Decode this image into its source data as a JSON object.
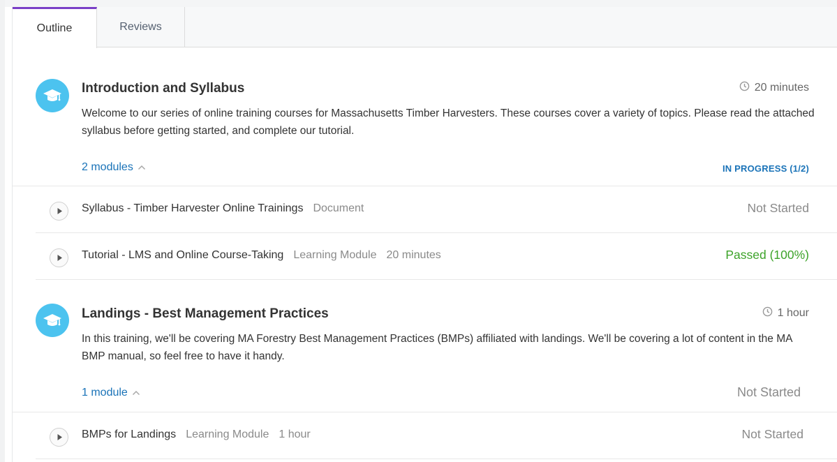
{
  "tabs": [
    {
      "label": "Outline"
    },
    {
      "label": "Reviews"
    }
  ],
  "colors": {
    "accent_tab": "#7a3fc7",
    "icon_bg": "#4cc3ef",
    "link": "#1a73b8",
    "passed": "#3da32a"
  },
  "sections": [
    {
      "title": "Introduction and Syllabus",
      "duration": "20 minutes",
      "description": "Welcome to our series of online training courses for Massachusetts Timber Harvesters. These courses cover a variety of topics. Please read the attached syllabus before getting started, and complete our tutorial.",
      "modules_label": "2 modules",
      "status": "IN PROGRESS (1/2)",
      "items": [
        {
          "title": "Syllabus - Timber Harvester Online Trainings",
          "type": "Document",
          "duration": "",
          "status": "Not Started"
        },
        {
          "title": "Tutorial - LMS and Online Course-Taking",
          "type": "Learning Module",
          "duration": "20 minutes",
          "status": "Passed (100%)"
        }
      ]
    },
    {
      "title": "Landings - Best Management Practices",
      "duration": "1 hour",
      "description": "In this training, we'll be covering MA Forestry Best Management Practices (BMPs) affiliated with landings. We'll be covering a lot of content in the MA BMP manual, so feel free to have it handy.",
      "modules_label": "1 module",
      "status": "Not Started",
      "items": [
        {
          "title": "BMPs for Landings",
          "type": "Learning Module",
          "duration": "1 hour",
          "status": "Not Started"
        }
      ]
    }
  ]
}
